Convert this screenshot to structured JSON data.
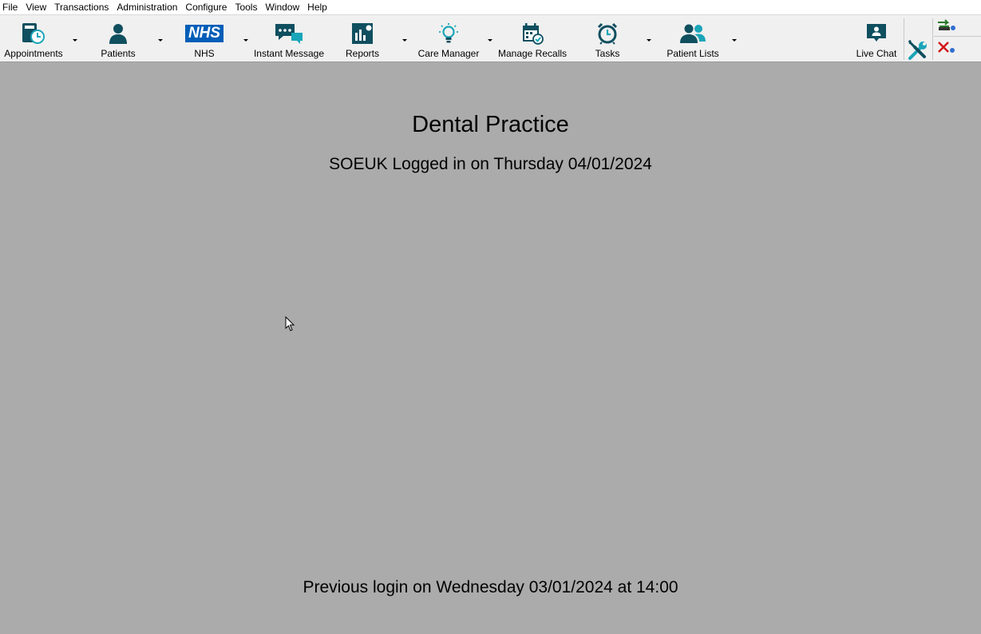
{
  "menu": [
    "File",
    "View",
    "Transactions",
    "Administration",
    "Configure",
    "Tools",
    "Window",
    "Help"
  ],
  "toolbar": {
    "appointments": "Appointments",
    "patients": "Patients",
    "nhs": "NHS",
    "nhs_logo": "NHS",
    "instant_message": "Instant Message",
    "reports": "Reports",
    "care_manager": "Care Manager",
    "manage_recalls": "Manage Recalls",
    "tasks": "Tasks",
    "patient_lists": "Patient Lists",
    "live_chat": "Live Chat"
  },
  "main": {
    "title": "Dental Practice",
    "login_line": "SOEUK Logged in on Thursday 04/01/2024",
    "previous_login": "Previous login on Wednesday 03/01/2024 at 14:00"
  },
  "colors": {
    "icon_dark": "#0f4f5f",
    "icon_accent": "#1aa5b8",
    "nhs_blue": "#005eb8",
    "background": "#ababab"
  }
}
